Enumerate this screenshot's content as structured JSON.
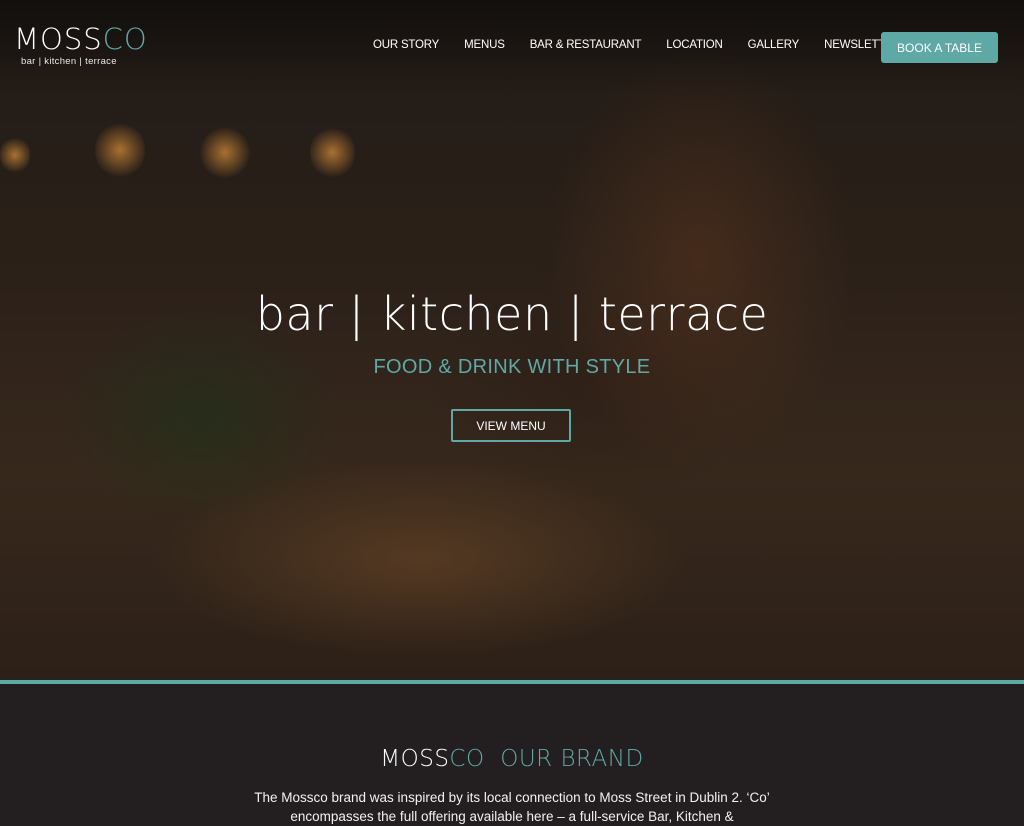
{
  "logo": {
    "main_a": "MOSS",
    "main_b": "CO",
    "tagline": "bar | kitchen | terrace"
  },
  "nav": {
    "items": [
      "OUR STORY",
      "MENUS",
      "BAR & RESTAURANT",
      "LOCATION",
      "GALLERY",
      "NEWSLETTER"
    ],
    "book_label": "BOOK A TABLE"
  },
  "hero": {
    "title": "bar | kitchen | terrace",
    "subtitle": "FOOD & DRINK WITH STYLE",
    "button_label": "VIEW MENU"
  },
  "brand": {
    "heading_a": "MOSS",
    "heading_b": "CO",
    "heading_c": "OUR BRAND",
    "text": "The Mossco brand was inspired by its local connection to Moss Street in Dublin 2. ‘Co’ encompasses the full offering available here – a full-service Bar, Kitchen &"
  },
  "colors": {
    "accent": "#5ea9a6",
    "background": "#231f20"
  }
}
